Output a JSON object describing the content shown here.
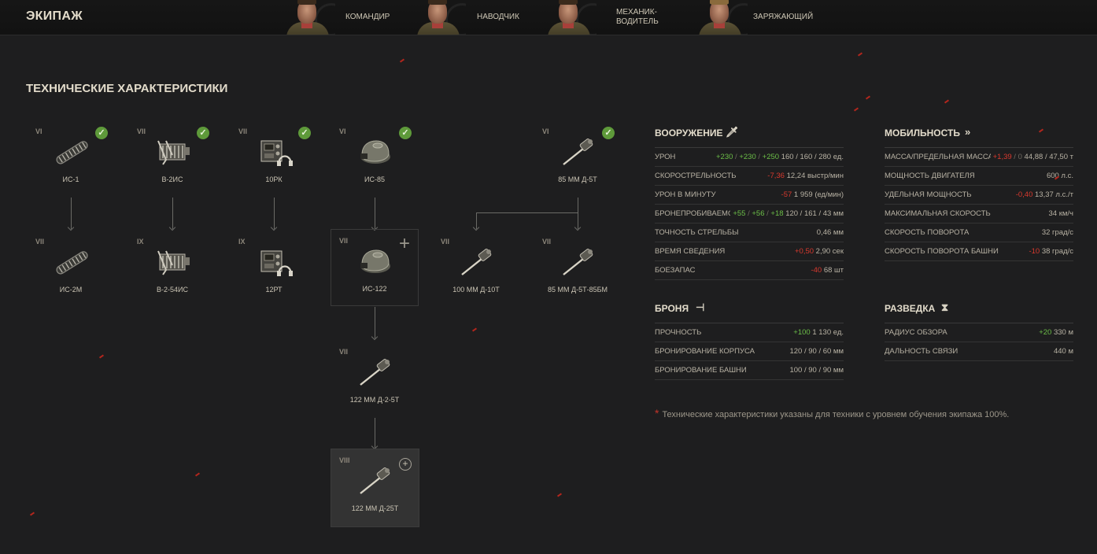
{
  "crew": {
    "title": "ЭКИПАЖ",
    "members": [
      {
        "label": "КОМАНДИР"
      },
      {
        "label": "НАВОДЧИК"
      },
      {
        "label": "МЕХАНИК-\nВОДИТЕЛЬ"
      },
      {
        "label": "ЗАРЯЖАЮЩИЙ"
      }
    ]
  },
  "tech_title": "ТЕХНИЧЕСКИЕ ХАРАКТЕРИСТИКИ",
  "modules": {
    "m1": {
      "tier": "VI",
      "name": "ИС-1",
      "icon": "tracks-icon",
      "researched": true
    },
    "m2": {
      "tier": "VII",
      "name": "В-2ИС",
      "icon": "engine-icon",
      "researched": true
    },
    "m3": {
      "tier": "VII",
      "name": "10РК",
      "icon": "radio-icon",
      "researched": true
    },
    "m4": {
      "tier": "VI",
      "name": "ИС-85",
      "icon": "turret-icon",
      "researched": true
    },
    "m5": {
      "tier": "VI",
      "name": "85 ММ Д-5Т",
      "icon": "gun-icon",
      "researched": true
    },
    "m6": {
      "tier": "VII",
      "name": "ИС-2М",
      "icon": "tracks-icon"
    },
    "m7": {
      "tier": "IX",
      "name": "В-2-54ИС",
      "icon": "engine-icon"
    },
    "m8": {
      "tier": "IX",
      "name": "12РТ",
      "icon": "radio-icon"
    },
    "m9": {
      "tier": "VII",
      "name": "ИС-122",
      "icon": "turret-icon",
      "plus": "+"
    },
    "m10": {
      "tier": "VII",
      "name": "100 ММ Д-10Т",
      "icon": "gun-icon"
    },
    "m11": {
      "tier": "VII",
      "name": "85 ММ Д-5Т-85БМ",
      "icon": "gun-icon"
    },
    "m12": {
      "tier": "VII",
      "name": "122 ММ Д-2-5Т",
      "icon": "gun-icon"
    },
    "m13": {
      "tier": "VIII",
      "name": "122 ММ Д-25Т",
      "icon": "gun-icon",
      "plus": "+"
    }
  },
  "armament": {
    "title": "ВООРУЖЕНИЕ",
    "icon": "sword-icon",
    "rows": [
      {
        "label": "УРОН",
        "d1": "+230",
        "d2": "+230",
        "d3": "+250",
        "value": "160 / 160 / 280 ед."
      },
      {
        "label": "СКОРОСТРЕЛЬНОСТЬ",
        "d1": "-7,36",
        "value": "12,24 выстр/мин"
      },
      {
        "label": "УРОН В МИНУТУ",
        "d1": "-57",
        "value": "1 959 (ед/мин)"
      },
      {
        "label": "БРОНЕПРОБИВАЕМОСТЬ",
        "d1": "+55",
        "d2": "+56",
        "d3": "+18",
        "value": "120 / 161 / 43 мм"
      },
      {
        "label": "ТОЧНОСТЬ СТРЕЛЬБЫ",
        "value": "0,46 мм"
      },
      {
        "label": "ВРЕМЯ СВЕДЕНИЯ",
        "d1": "+0,50",
        "value": "2,90 сек"
      },
      {
        "label": "БОЕЗАПАС",
        "d1": "-40",
        "value": "68 шт"
      }
    ]
  },
  "armor": {
    "title": "БРОНЯ",
    "icon": "armor-icon",
    "rows": [
      {
        "label": "ПРОЧНОСТЬ",
        "d1": "+100",
        "value": "1 130 ед."
      },
      {
        "label": "БРОНИРОВАНИЕ КОРПУСА",
        "value": "120 / 90 / 60 мм"
      },
      {
        "label": "БРОНИРОВАНИЕ БАШНИ",
        "value": "100 / 90 / 90 мм"
      }
    ]
  },
  "mobility": {
    "title": "МОБИЛЬНОСТЬ",
    "icon": "double-chevron-icon",
    "rows": [
      {
        "label": "МАССА/ПРЕДЕЛЬНАЯ МАССА",
        "d1": "+1,39",
        "d2": "0",
        "value": "44,88 / 47,50 т"
      },
      {
        "label": "МОЩНОСТЬ ДВИГАТЕЛЯ",
        "value": "600 л.с."
      },
      {
        "label": "УДЕЛЬНАЯ МОЩНОСТЬ",
        "d1": "-0,40",
        "value": "13,37 л.с./т"
      },
      {
        "label": "МАКСИМАЛЬНАЯ СКОРОСТЬ",
        "value": "34 км/ч"
      },
      {
        "label": "СКОРОСТЬ ПОВОРОТА",
        "value": "32 град/с"
      },
      {
        "label": "СКОРОСТЬ ПОВОРОТА БАШНИ",
        "d1": "-10",
        "value": "38 град/с"
      }
    ]
  },
  "recon": {
    "title": "РАЗВЕДКА",
    "icon": "binoculars-icon",
    "rows": [
      {
        "label": "РАДИУС ОБЗОРА",
        "d1": "+20",
        "value": "330 м"
      },
      {
        "label": "ДАЛЬНОСТЬ СВЯЗИ",
        "value": "440 м"
      }
    ]
  },
  "footnote": {
    "star": "*",
    "text": "Технические характеристики указаны для техники с уровнем обучения экипажа 100%."
  },
  "colors": {
    "positive": "#6cbe48",
    "negative": "#d8392e",
    "researched": "#5e9a3a"
  }
}
